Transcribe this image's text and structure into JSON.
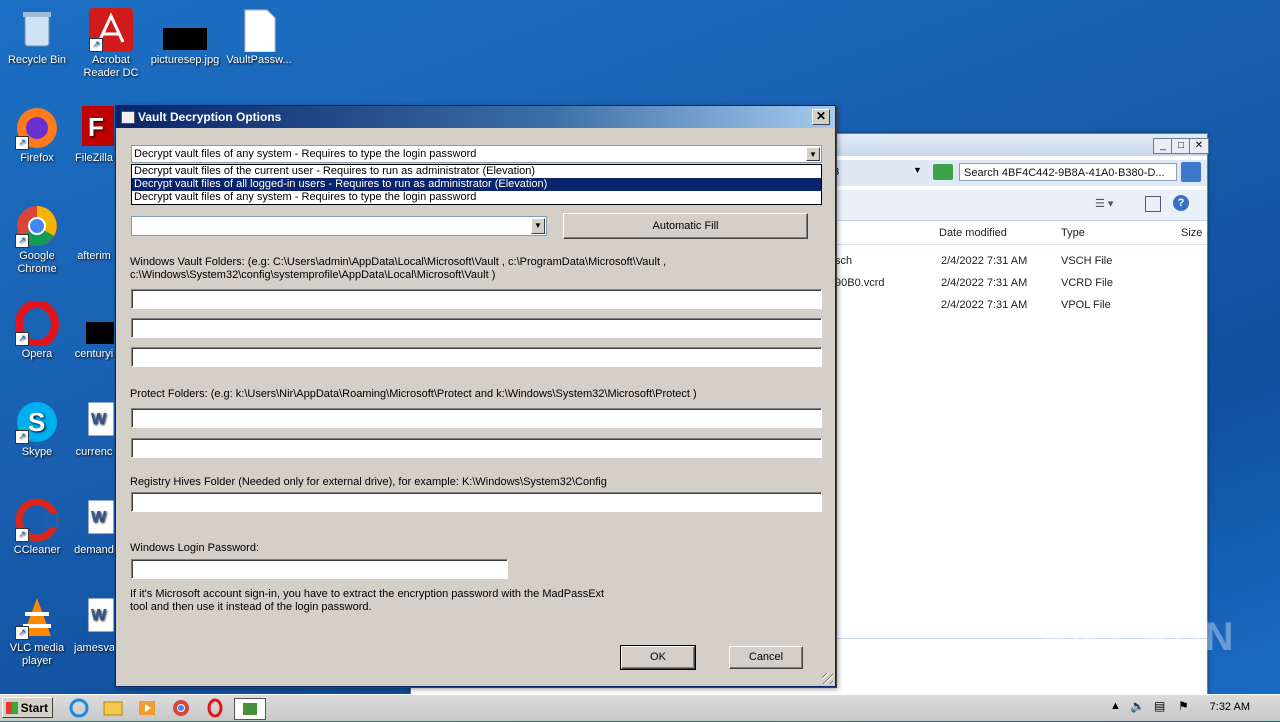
{
  "desktop": {
    "icons": [
      {
        "label": "Recycle Bin"
      },
      {
        "label": "Acrobat Reader DC"
      },
      {
        "label": "picturesep.jpg"
      },
      {
        "label": "VaultPassw..."
      },
      {
        "label": "Firefox"
      },
      {
        "label": "FileZilla"
      },
      {
        "label": "Google Chrome"
      },
      {
        "label": "afterim"
      },
      {
        "label": "Opera"
      },
      {
        "label": "centuryi"
      },
      {
        "label": "Skype"
      },
      {
        "label": "currenc"
      },
      {
        "label": "CCleaner"
      },
      {
        "label": "demand"
      },
      {
        "label": "VLC media player"
      },
      {
        "label": "jamesva"
      }
    ]
  },
  "explorer": {
    "search_placeholder": "Search 4BF4C442-9B8A-41A0-B380-D...",
    "address_fragment": "3",
    "columns": [
      "Date modified",
      "Type",
      "Size"
    ],
    "rows": [
      {
        "name": "sch",
        "date": "2/4/2022 7:31 AM",
        "type": "VSCH File"
      },
      {
        "name": "90B0.vcrd",
        "date": "2/4/2022 7:31 AM",
        "type": "VCRD File"
      },
      {
        "name": "",
        "date": "2/4/2022 7:31 AM",
        "type": "VPOL File"
      }
    ]
  },
  "dialog": {
    "title": "Vault Decryption Options",
    "mode_selected": "Decrypt vault files of any system - Requires to type the login password",
    "mode_options": [
      "Decrypt vault files of the current user - Requires to run as administrator (Elevation)",
      "Decrypt vault files of all logged-in users - Requires to run as administrator (Elevation)",
      "Decrypt vault files of any system - Requires to type the login password"
    ],
    "automatic_fill": "Automatic Fill",
    "vault_folders_label_1": "Windows Vault Folders:  (e.g: C:\\Users\\admin\\AppData\\Local\\Microsoft\\Vault , c:\\ProgramData\\Microsoft\\Vault ,",
    "vault_folders_label_2": "c:\\Windows\\System32\\config\\systemprofile\\AppData\\Local\\Microsoft\\Vault )",
    "protect_label": "Protect Folders: (e.g: k:\\Users\\Nir\\AppData\\Roaming\\Microsoft\\Protect and k:\\Windows\\System32\\Microsoft\\Protect )",
    "registry_label": "Registry Hives Folder (Needed only for external drive), for example:  K:\\Windows\\System32\\Config",
    "password_label": "Windows Login Password:",
    "note_1": "If it's Microsoft account sign-in, you have to extract the encryption password with the MadPassExt",
    "note_2": "tool and then use it instead of the login password.",
    "ok": "OK",
    "cancel": "Cancel"
  },
  "taskbar": {
    "start": "Start",
    "clock": "7:32 AM"
  },
  "watermark": "ANY RUN"
}
